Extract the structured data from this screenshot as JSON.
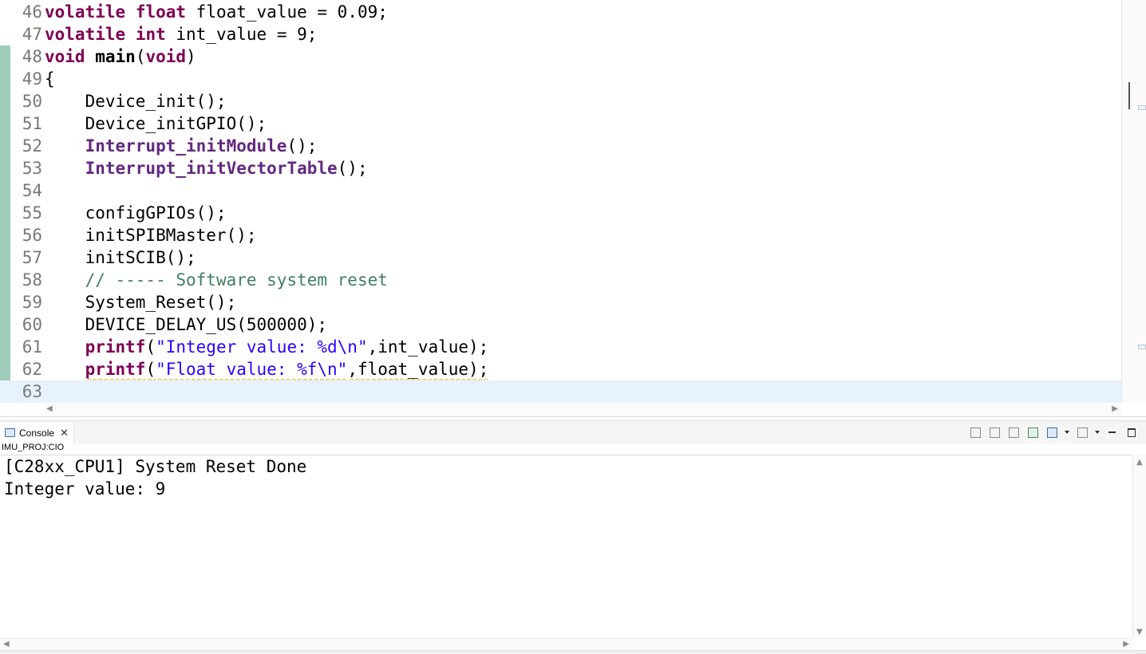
{
  "editor": {
    "lines": [
      {
        "num": "46",
        "segments": [
          {
            "t": "volatile",
            "c": "kw"
          },
          {
            "t": " "
          },
          {
            "t": "float",
            "c": "kw"
          },
          {
            "t": " float_value = 0.09;"
          }
        ]
      },
      {
        "num": "47",
        "segments": [
          {
            "t": "volatile",
            "c": "kw"
          },
          {
            "t": " "
          },
          {
            "t": "int",
            "c": "kw"
          },
          {
            "t": " int_value = 9;"
          }
        ]
      },
      {
        "num": "48",
        "segments": [
          {
            "t": "void",
            "c": "kw"
          },
          {
            "t": " "
          },
          {
            "t": "main",
            "c": "bold"
          },
          {
            "t": "("
          },
          {
            "t": "void",
            "c": "kw"
          },
          {
            "t": ")"
          }
        ]
      },
      {
        "num": "49",
        "segments": [
          {
            "t": "{"
          }
        ]
      },
      {
        "num": "50",
        "segments": [
          {
            "t": "    Device_init();"
          }
        ]
      },
      {
        "num": "51",
        "segments": [
          {
            "t": "    Device_initGPIO();"
          }
        ]
      },
      {
        "num": "52",
        "segments": [
          {
            "t": "    "
          },
          {
            "t": "Interrupt_initModule",
            "c": "fn-bold"
          },
          {
            "t": "();"
          }
        ]
      },
      {
        "num": "53",
        "segments": [
          {
            "t": "    "
          },
          {
            "t": "Interrupt_initVectorTable",
            "c": "fn-bold"
          },
          {
            "t": "();"
          }
        ]
      },
      {
        "num": "54",
        "segments": []
      },
      {
        "num": "55",
        "segments": [
          {
            "t": "    configGPIOs();"
          }
        ]
      },
      {
        "num": "56",
        "segments": [
          {
            "t": "    initSPIBMaster();"
          }
        ]
      },
      {
        "num": "57",
        "segments": [
          {
            "t": "    initSCIB();"
          }
        ]
      },
      {
        "num": "58",
        "segments": [
          {
            "t": "    "
          },
          {
            "t": "// ----- Software system reset",
            "c": "cmt"
          }
        ]
      },
      {
        "num": "59",
        "segments": [
          {
            "t": "    System_Reset();"
          }
        ]
      },
      {
        "num": "60",
        "segments": [
          {
            "t": "    DEVICE_DELAY_US(500000);"
          }
        ]
      },
      {
        "num": "61",
        "segments": [
          {
            "t": "    "
          },
          {
            "t": "printf",
            "c": "kw"
          },
          {
            "t": "("
          },
          {
            "t": "\"Integer value: %d\\n\"",
            "c": "str"
          },
          {
            "t": ",int_value);"
          }
        ]
      },
      {
        "num": "62",
        "segments": [
          {
            "t": "    "
          },
          {
            "t": "printf",
            "c": "kw squiggle"
          },
          {
            "t": "(",
            "c": "squiggle"
          },
          {
            "t": "\"Float value: %f\\n\"",
            "c": "str squiggle"
          },
          {
            "t": ",float_value);",
            "c": "squiggle"
          }
        ]
      },
      {
        "num": "63",
        "segments": [],
        "current": true
      }
    ]
  },
  "console": {
    "tab_label": "Console",
    "subtitle": "IMU_PROJ:CIO",
    "output_lines": [
      "[C28xx_CPU1] System Reset Done",
      "Integer value: 9"
    ],
    "toolbar_icons": [
      "clear-console-icon",
      "scroll-lock-icon",
      "word-wrap-icon",
      "pin-console-icon",
      "display-console-icon",
      "open-console-icon",
      "minimize-icon",
      "maximize-icon"
    ]
  },
  "colors": {
    "keyword": "#7f0055",
    "function_bold": "#642880",
    "string": "#2a00ff",
    "comment": "#3f7f5f",
    "current_line": "#e8f2fe",
    "gutter_change": "#9fcdb9"
  }
}
